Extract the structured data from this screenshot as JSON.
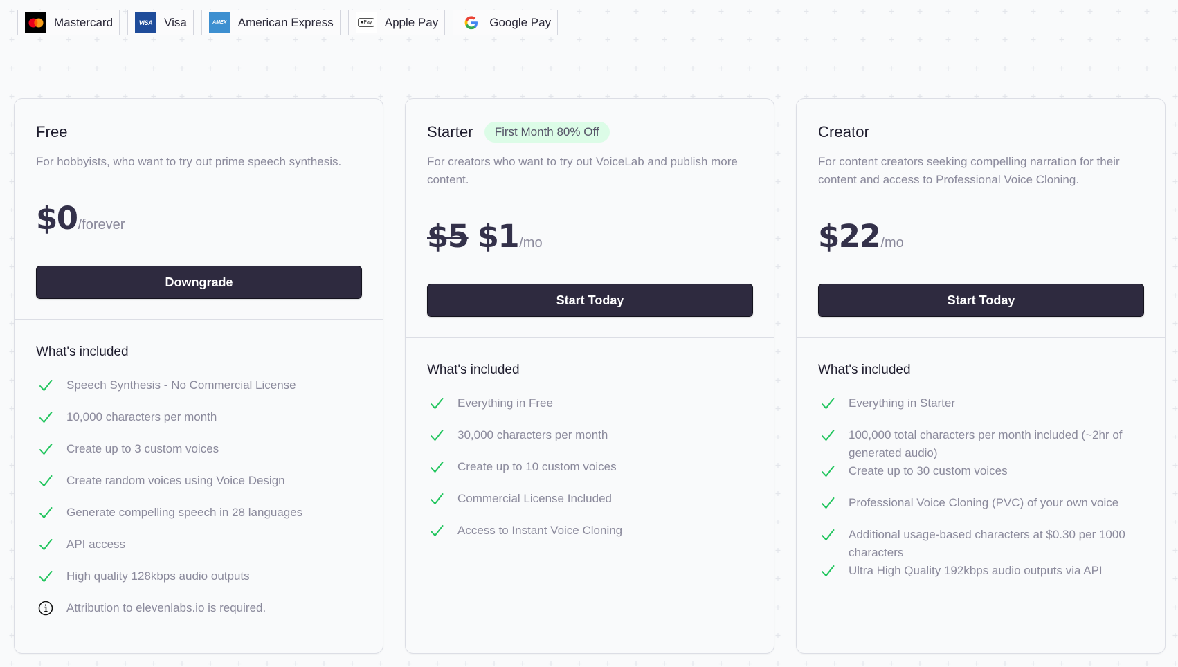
{
  "payment_methods": [
    {
      "name": "Mastercard",
      "icon": "mastercard-logo"
    },
    {
      "name": "Visa",
      "icon": "visa-logo",
      "logo_text": "VISA"
    },
    {
      "name": "American Express",
      "icon": "amex-logo",
      "logo_text": "AMEX"
    },
    {
      "name": "Apple Pay",
      "icon": "apple-pay-logo",
      "logo_text": "Pay"
    },
    {
      "name": "Google Pay",
      "icon": "google-logo"
    }
  ],
  "colors": {
    "button_bg": "#2e2a3f",
    "check_green": "#22c55e",
    "badge_bg": "#dcfce7",
    "muted_text": "#8b8a9c",
    "card_border": "#dcdee5"
  },
  "plans": [
    {
      "name": "Free",
      "description": "For hobbyists, who want to try out prime speech synthesis.",
      "price": "$0",
      "price_unit": "/forever",
      "cta": "Downgrade",
      "included_title": "What's included",
      "features": [
        {
          "icon": "check",
          "text": "Speech Synthesis - No Commercial License"
        },
        {
          "icon": "check",
          "text": "10,000 characters per month"
        },
        {
          "icon": "check",
          "text": "Create up to 3 custom voices"
        },
        {
          "icon": "check",
          "text": "Create random voices using Voice Design"
        },
        {
          "icon": "check",
          "text": "Generate compelling speech in 28 languages"
        },
        {
          "icon": "check",
          "text": "API access"
        },
        {
          "icon": "check",
          "text": "High quality 128kbps audio outputs"
        },
        {
          "icon": "info",
          "text": "Attribution to elevenlabs.io is required."
        }
      ]
    },
    {
      "name": "Starter",
      "badge": "First Month 80% Off",
      "description": "For creators who want to try out VoiceLab and publish more content.",
      "price_old": "$5",
      "price": "$1",
      "price_unit": "/mo",
      "cta": "Start Today",
      "included_title": "What's included",
      "features": [
        {
          "icon": "check",
          "text": "Everything in Free"
        },
        {
          "icon": "check",
          "text": "30,000 characters per month"
        },
        {
          "icon": "check",
          "text": "Create up to 10 custom voices"
        },
        {
          "icon": "check",
          "text": "Commercial License Included"
        },
        {
          "icon": "check",
          "text": "Access to Instant Voice Cloning"
        }
      ]
    },
    {
      "name": "Creator",
      "description": "For content creators seeking compelling narration for their content and access to Professional Voice Cloning.",
      "price": "$22",
      "price_unit": "/mo",
      "cta": "Start Today",
      "included_title": "What's included",
      "features": [
        {
          "icon": "check",
          "text": "Everything in Starter"
        },
        {
          "icon": "check",
          "text": "100,000 total characters per month included (~2hr of generated audio)"
        },
        {
          "icon": "check",
          "text": "Create up to 30 custom voices"
        },
        {
          "icon": "check",
          "text": "Professional Voice Cloning (PVC) of your own voice"
        },
        {
          "icon": "check",
          "text": "Additional usage-based characters at $0.30 per 1000 characters"
        },
        {
          "icon": "check",
          "text": "Ultra High Quality 192kbps audio outputs via API"
        }
      ]
    }
  ]
}
